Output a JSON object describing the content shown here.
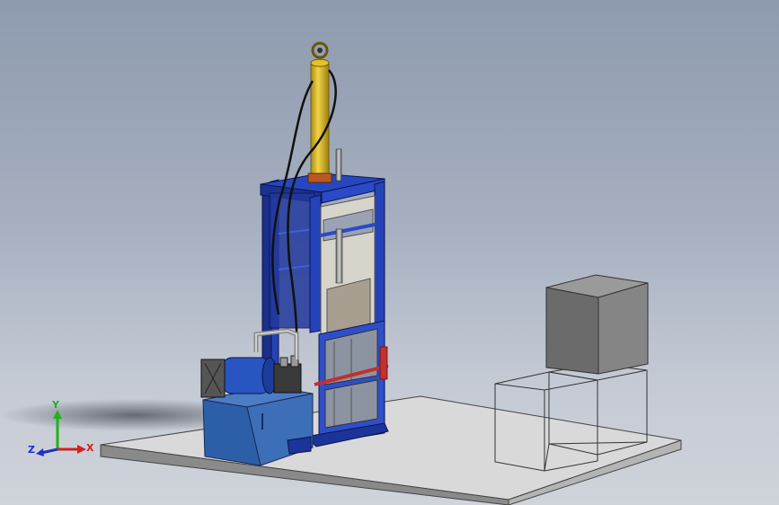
{
  "viewport": {
    "background_top": "#8e9aae",
    "background_bottom": "#cfd3da"
  },
  "triad": {
    "x_label": "X",
    "y_label": "Y",
    "z_label": "Z",
    "x_color": "#d22020",
    "y_color": "#20b020",
    "z_color": "#2030c8"
  },
  "model": {
    "frame_color": "#1f3fb5",
    "cylinder_color": "#e6c12a",
    "tank_color": "#3565a8",
    "floor_color": "#d8d8d8",
    "bale_color": "#6e6e6e",
    "handle_color": "#c23030"
  }
}
